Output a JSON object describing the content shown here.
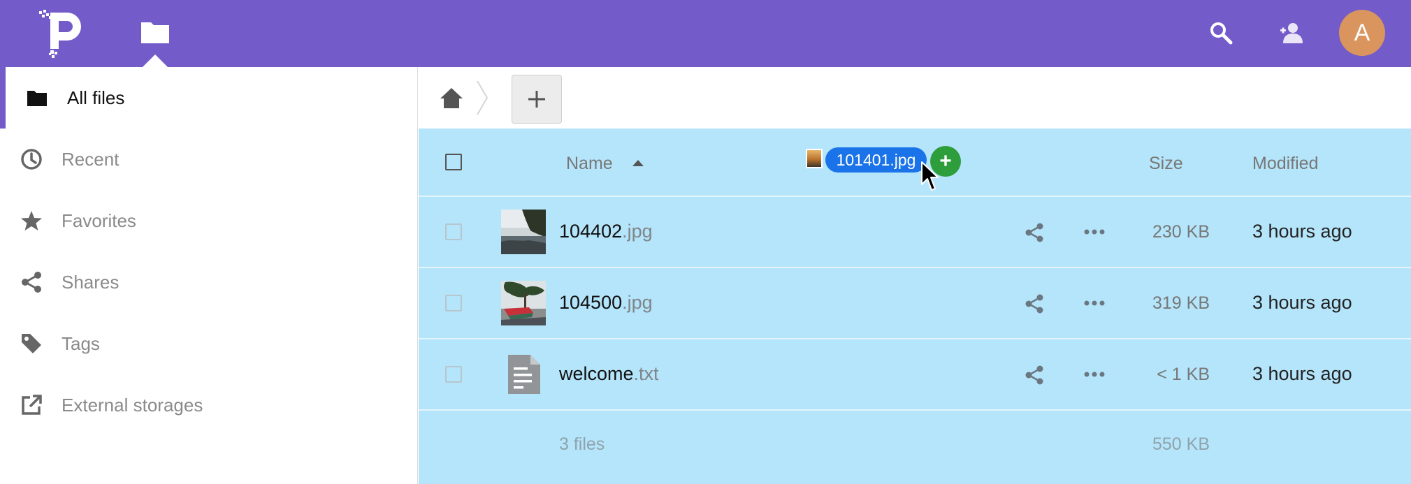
{
  "header": {
    "logo": "pydio-logo",
    "app_icon": "folder-icon",
    "search_icon": "search-icon",
    "contacts_icon": "contacts-icon",
    "avatar_letter": "A",
    "bg_color": "#745bca",
    "avatar_color": "#d9955d"
  },
  "sidebar": {
    "items": [
      {
        "label": "All files",
        "icon": "folder-icon",
        "active": true
      },
      {
        "label": "Recent",
        "icon": "clock-icon",
        "active": false
      },
      {
        "label": "Favorites",
        "icon": "star-icon",
        "active": false
      },
      {
        "label": "Shares",
        "icon": "share-icon",
        "active": false
      },
      {
        "label": "Tags",
        "icon": "tag-icon",
        "active": false
      },
      {
        "label": "External storages",
        "icon": "external-link-icon",
        "active": false
      }
    ]
  },
  "controls": {
    "home_icon": "home-icon",
    "add_label": "+"
  },
  "filelist": {
    "columns": {
      "name": "Name",
      "size": "Size",
      "modified": "Modified"
    },
    "sort_icon": "sort-ascending-icon",
    "files": [
      {
        "basename": "104402",
        "ext": ".jpg",
        "size": "230 KB",
        "modified": "3 hours ago",
        "thumb": "coast-photo"
      },
      {
        "basename": "104500",
        "ext": ".jpg",
        "size": "319 KB",
        "modified": "3 hours ago",
        "thumb": "boat-photo"
      },
      {
        "basename": "welcome",
        "ext": ".txt",
        "size": "< 1 KB",
        "modified": "3 hours ago",
        "thumb": "text-file-icon"
      }
    ],
    "summary": {
      "count": "3 files",
      "size": "550 KB"
    },
    "bg_color": "#b5e5fa"
  },
  "drag": {
    "filename": "101401.jpg",
    "add_symbol": "+",
    "label_color": "#1a73e8",
    "add_color": "#2e9e3c"
  }
}
